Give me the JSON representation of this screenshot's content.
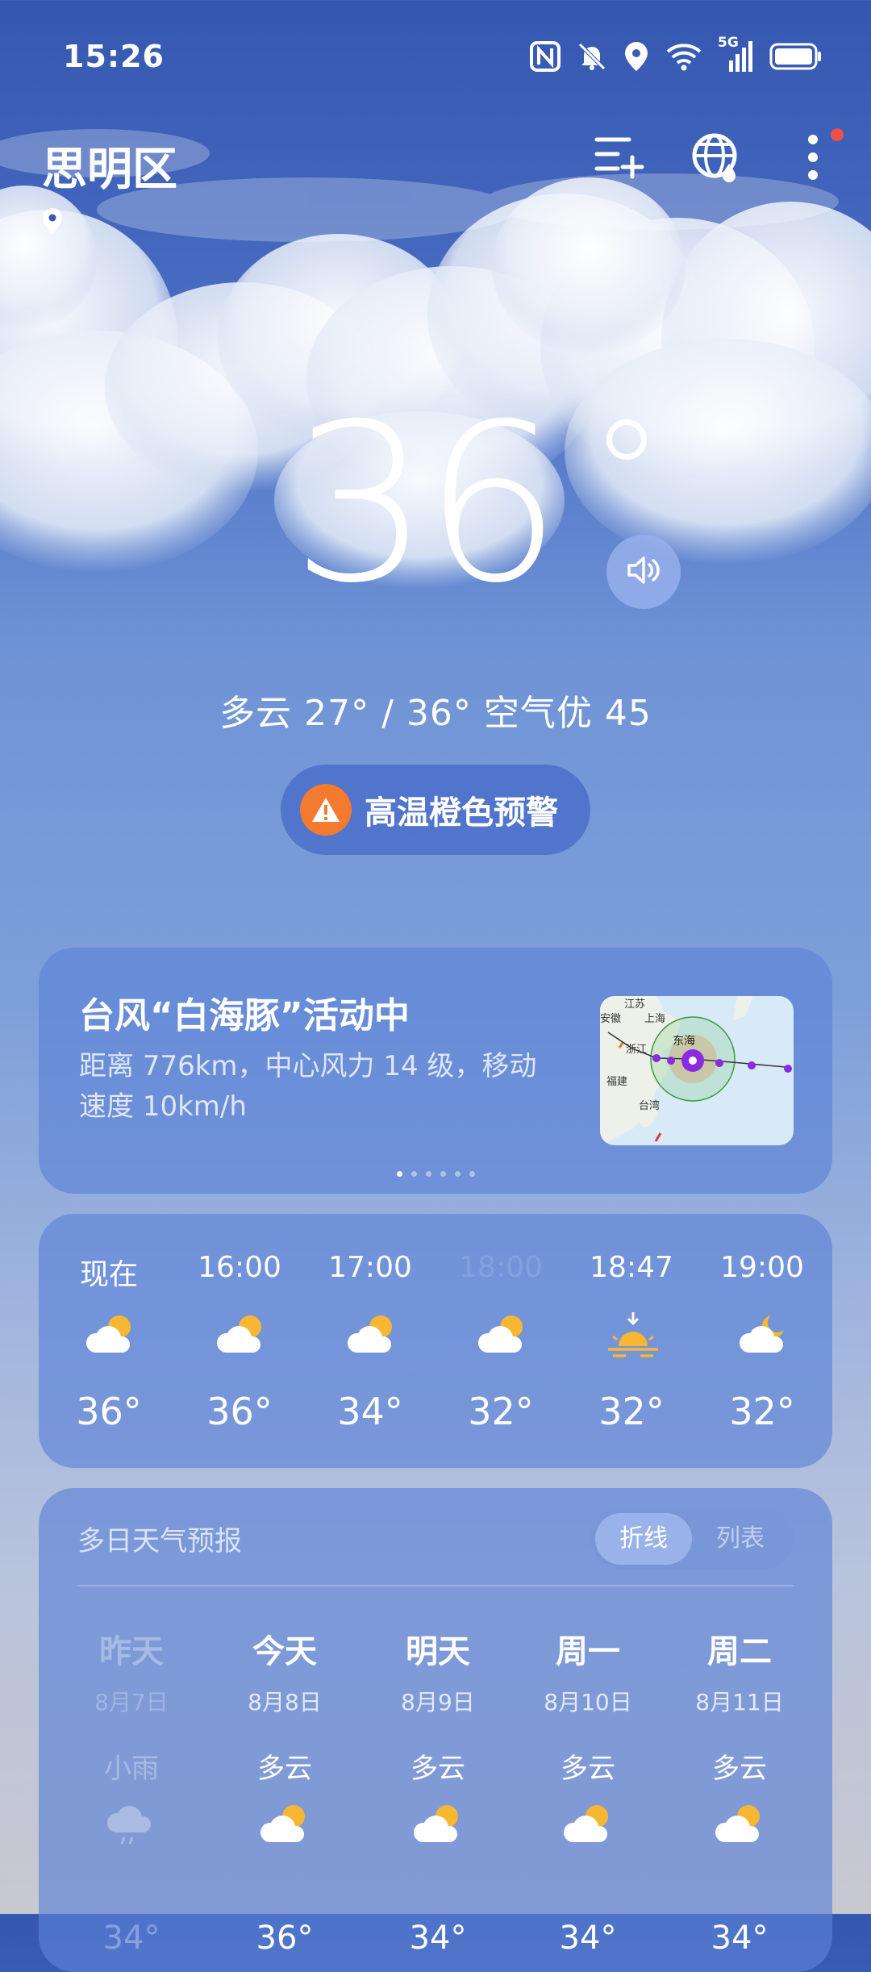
{
  "status_bar": {
    "time": "15:26",
    "network_label": "5G",
    "icons": [
      "nfc-icon",
      "mute-bell-icon",
      "location-icon",
      "wifi-icon",
      "signal-icon",
      "battery-icon"
    ]
  },
  "header": {
    "city": "思明区",
    "buttons": [
      "add-city-icon",
      "globe-icon",
      "more-icon"
    ],
    "has_notification_dot": true
  },
  "current": {
    "temperature": "36",
    "summary": "多云 27° / 36° 空气优 45"
  },
  "warning": {
    "label": "高温橙色预警",
    "color": "#f47a30"
  },
  "typhoon": {
    "title": "台风“白海豚”活动中",
    "description": "距离 776km，中心风力 14 级，移动速度 10km/h",
    "map_labels": [
      "江苏",
      "安徽",
      "上海",
      "浙江",
      "东海",
      "福建",
      "台湾"
    ],
    "page_count": 6,
    "active_page": 0
  },
  "hourly": [
    {
      "time": "现在",
      "icon": "partly-cloudy-icon",
      "temp": "36°",
      "faded": false
    },
    {
      "time": "16:00",
      "icon": "partly-cloudy-icon",
      "temp": "36°",
      "faded": false
    },
    {
      "time": "17:00",
      "icon": "partly-cloudy-icon",
      "temp": "34°",
      "faded": false
    },
    {
      "time": "18:00",
      "icon": "partly-cloudy-icon",
      "temp": "32°",
      "faded": true
    },
    {
      "time": "18:47",
      "icon": "sunset-icon",
      "temp": "32°",
      "faded": false
    },
    {
      "time": "19:00",
      "icon": "partly-cloudy-night-icon",
      "temp": "32°",
      "faded": false
    }
  ],
  "forecast": {
    "title": "多日天气预报",
    "toggle_active": "折线",
    "toggle_inactive": "列表",
    "days": [
      {
        "name": "昨天",
        "date": "8月7日",
        "condition": "小雨",
        "icon": "rain-icon",
        "high": "34°",
        "past": true
      },
      {
        "name": "今天",
        "date": "8月8日",
        "condition": "多云",
        "icon": "partly-cloudy-icon",
        "high": "36°",
        "past": false
      },
      {
        "name": "明天",
        "date": "8月9日",
        "condition": "多云",
        "icon": "partly-cloudy-icon",
        "high": "34°",
        "past": false
      },
      {
        "name": "周一",
        "date": "8月10日",
        "condition": "多云",
        "icon": "partly-cloudy-icon",
        "high": "34°",
        "past": false
      },
      {
        "name": "周二",
        "date": "8月11日",
        "condition": "多云",
        "icon": "partly-cloudy-icon",
        "high": "34°",
        "past": false
      }
    ]
  }
}
